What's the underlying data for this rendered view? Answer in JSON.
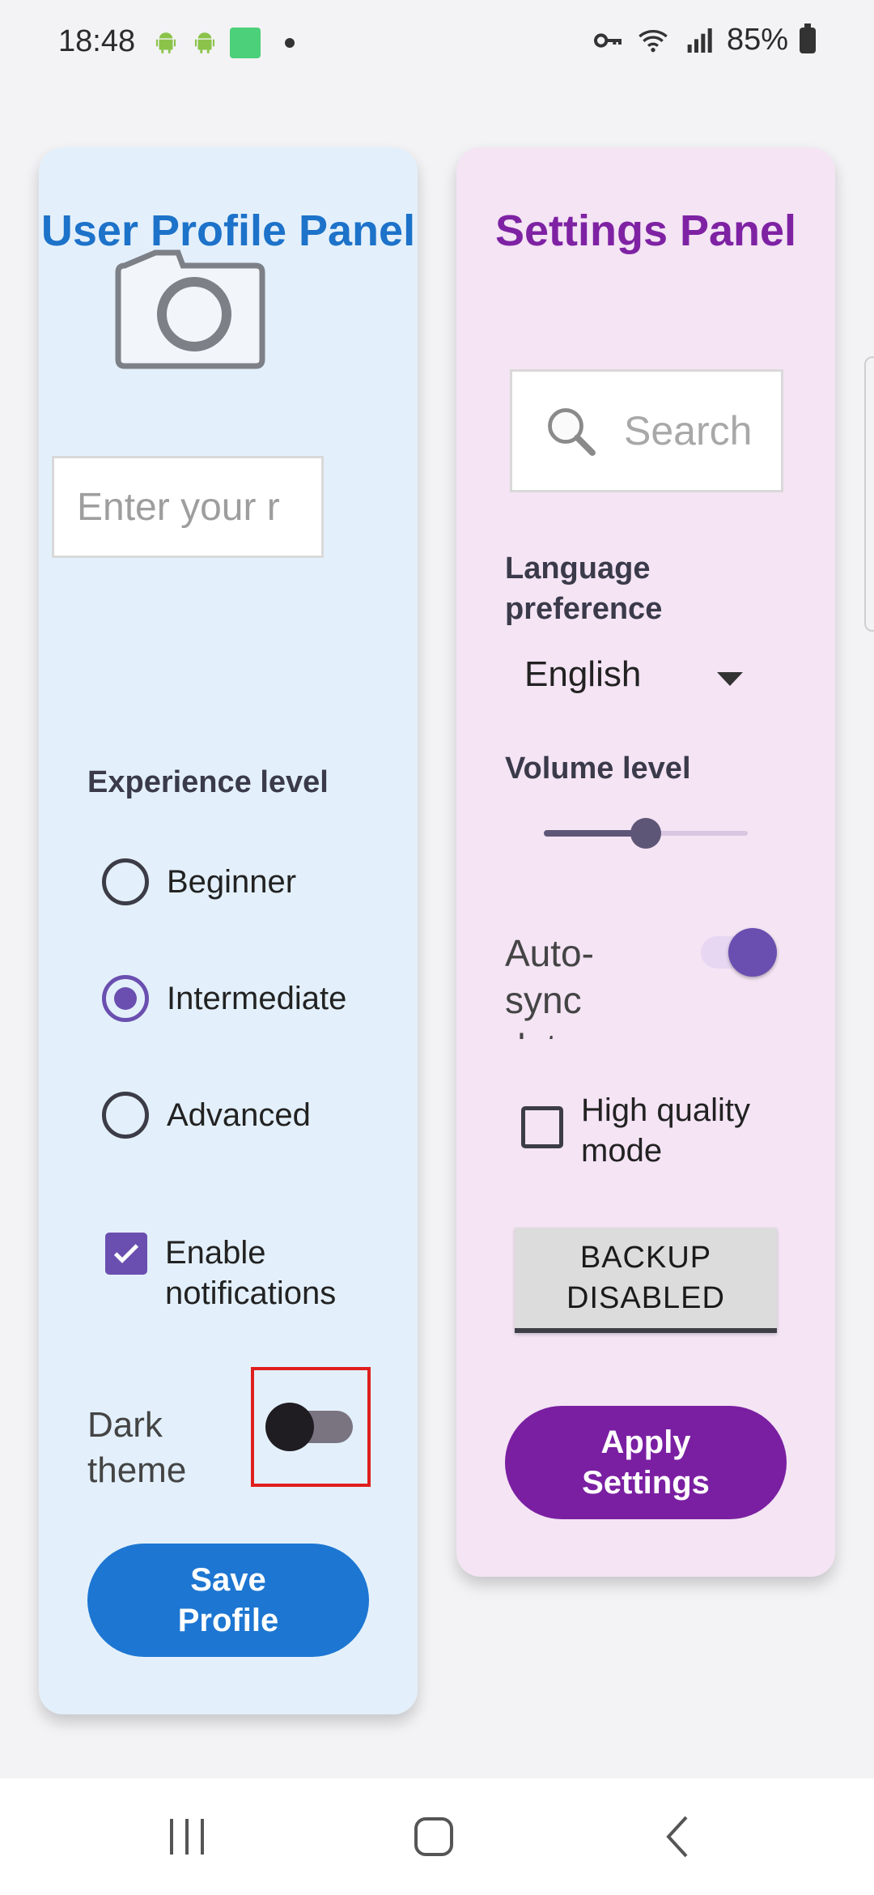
{
  "status_bar": {
    "time": "18:48",
    "battery": "85%",
    "left_icons": [
      "android-icon",
      "android-icon",
      "app-notification-icon",
      "dot-icon"
    ],
    "right_icons": [
      "vpn-key-icon",
      "wifi-icon",
      "signal-icon",
      "battery-icon"
    ]
  },
  "profile_panel": {
    "title": "User Profile Panel",
    "name_placeholder": "Enter your name",
    "name_visible_text": "Enter your r",
    "experience_label": "Experience level",
    "experience_options": [
      {
        "label": "Beginner",
        "checked": false
      },
      {
        "label": "Intermediate",
        "checked": true
      },
      {
        "label": "Advanced",
        "checked": false
      }
    ],
    "notifications_label": "Enable notifications",
    "notifications_checked": true,
    "dark_theme_label": "Dark theme",
    "dark_theme_on": false,
    "save_button": "Save Profile"
  },
  "settings_panel": {
    "title": "Settings Panel",
    "search_placeholder": "Search",
    "search_visible_text": "Search",
    "language_label": "Language preference",
    "language_value": "English",
    "volume_label": "Volume level",
    "volume_value": 0.5,
    "auto_sync_label": "Auto-sync data",
    "auto_sync_on": true,
    "high_quality_label": "High quality mode",
    "high_quality_checked": false,
    "backup_button": "BACKUP DISABLED",
    "apply_button": "Apply Settings"
  },
  "colors": {
    "profile_accent": "#1d72c9",
    "settings_accent": "#7e22a3",
    "control_purple": "#6a4fb0",
    "highlight_red": "#e01e1e"
  },
  "nav_bar": {
    "buttons": [
      "recent-apps-icon",
      "home-icon",
      "back-icon"
    ]
  }
}
